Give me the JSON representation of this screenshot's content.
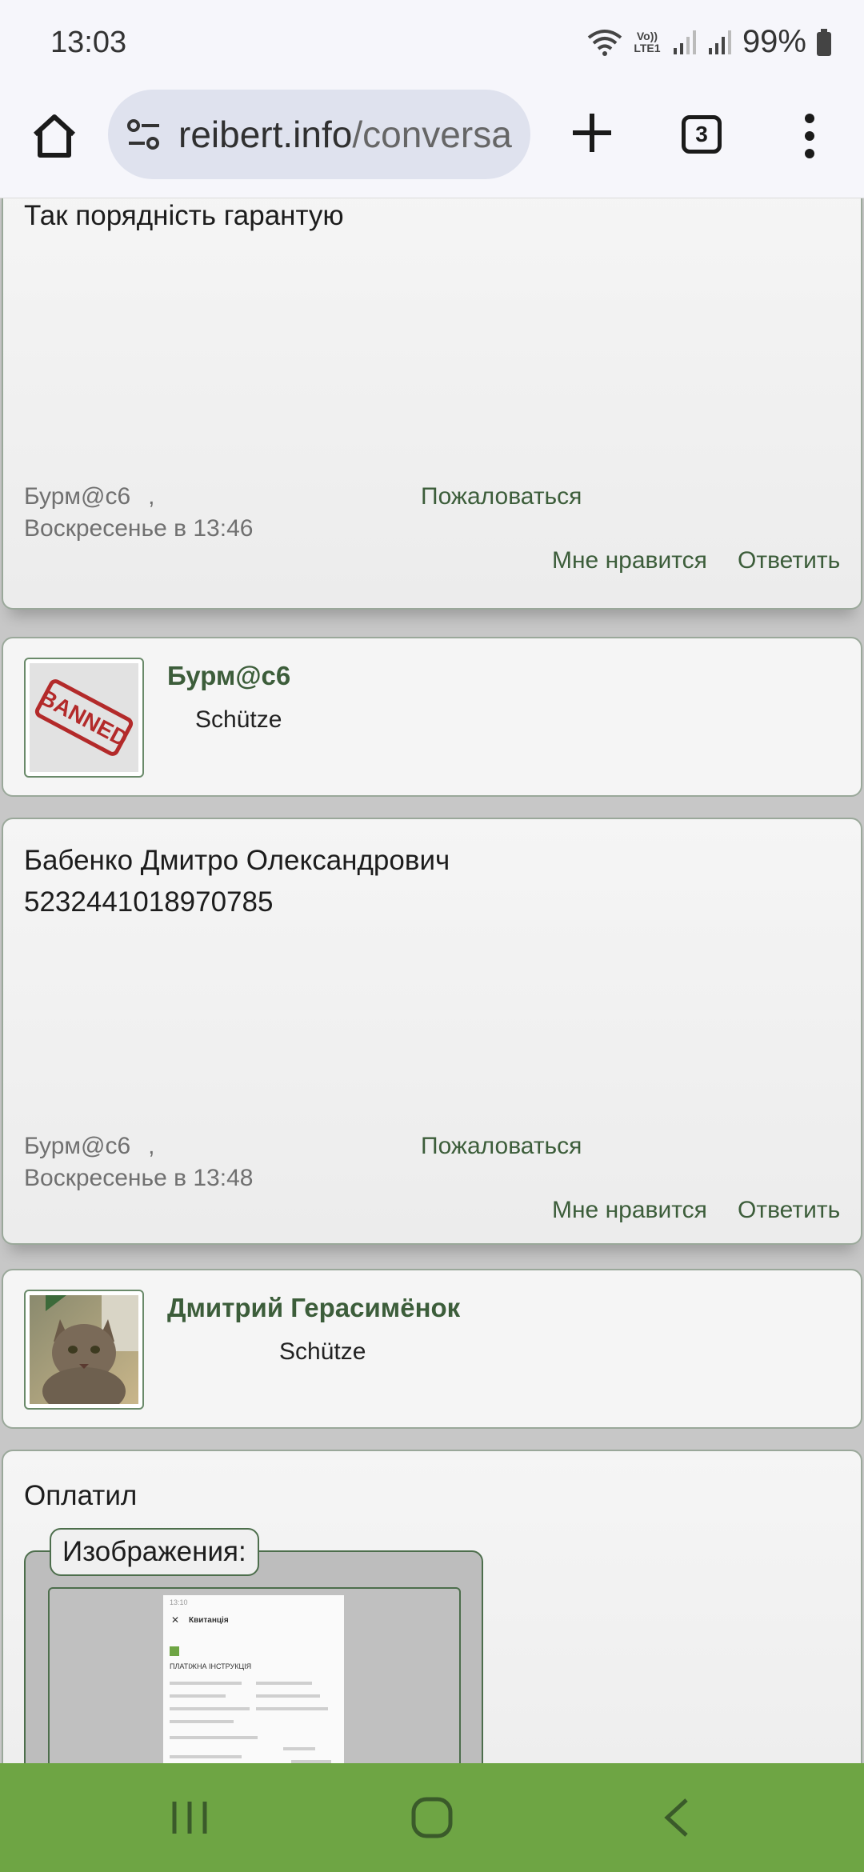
{
  "status": {
    "time": "13:03",
    "battery": "99%",
    "network": "Vo)) LTE1"
  },
  "browser": {
    "url_domain": "reibert.info",
    "url_path": "/conversa",
    "tab_count": "3"
  },
  "posts": [
    {
      "text_lines": [
        "Так порядність гарантую"
      ],
      "author": "Бурм@с6",
      "sep": ",",
      "date": "Воскресенье в 13:46",
      "report": "Пожаловаться",
      "like": "Мне нравится",
      "reply": "Ответить"
    },
    {
      "text_lines": [
        "Бабенко Дмитро Олександрович",
        "5232441018970785"
      ],
      "author": "Бурм@с6",
      "sep": ",",
      "date": "Воскресенье в 13:48",
      "report": "Пожаловаться",
      "like": "Мне нравится",
      "reply": "Ответить"
    },
    {
      "text_lines": [
        "Оплатил"
      ],
      "attachments_label": "Изображения:"
    }
  ],
  "users": [
    {
      "name": "Бурм@с6",
      "title": "Schütze",
      "avatar": "banned-stamp",
      "stamp_text": "BANNED"
    },
    {
      "name": "Дмитрий Герасимёнок",
      "title": "Schütze",
      "avatar": "cat-photo"
    }
  ],
  "thumb": {
    "time": "13:10",
    "header": "Квитанція",
    "heading": "ПЛАТІЖНА ІНСТРУКЦІЯ"
  },
  "colors": {
    "accent": "#3c5d3a",
    "nav_bar": "#6ea544"
  }
}
